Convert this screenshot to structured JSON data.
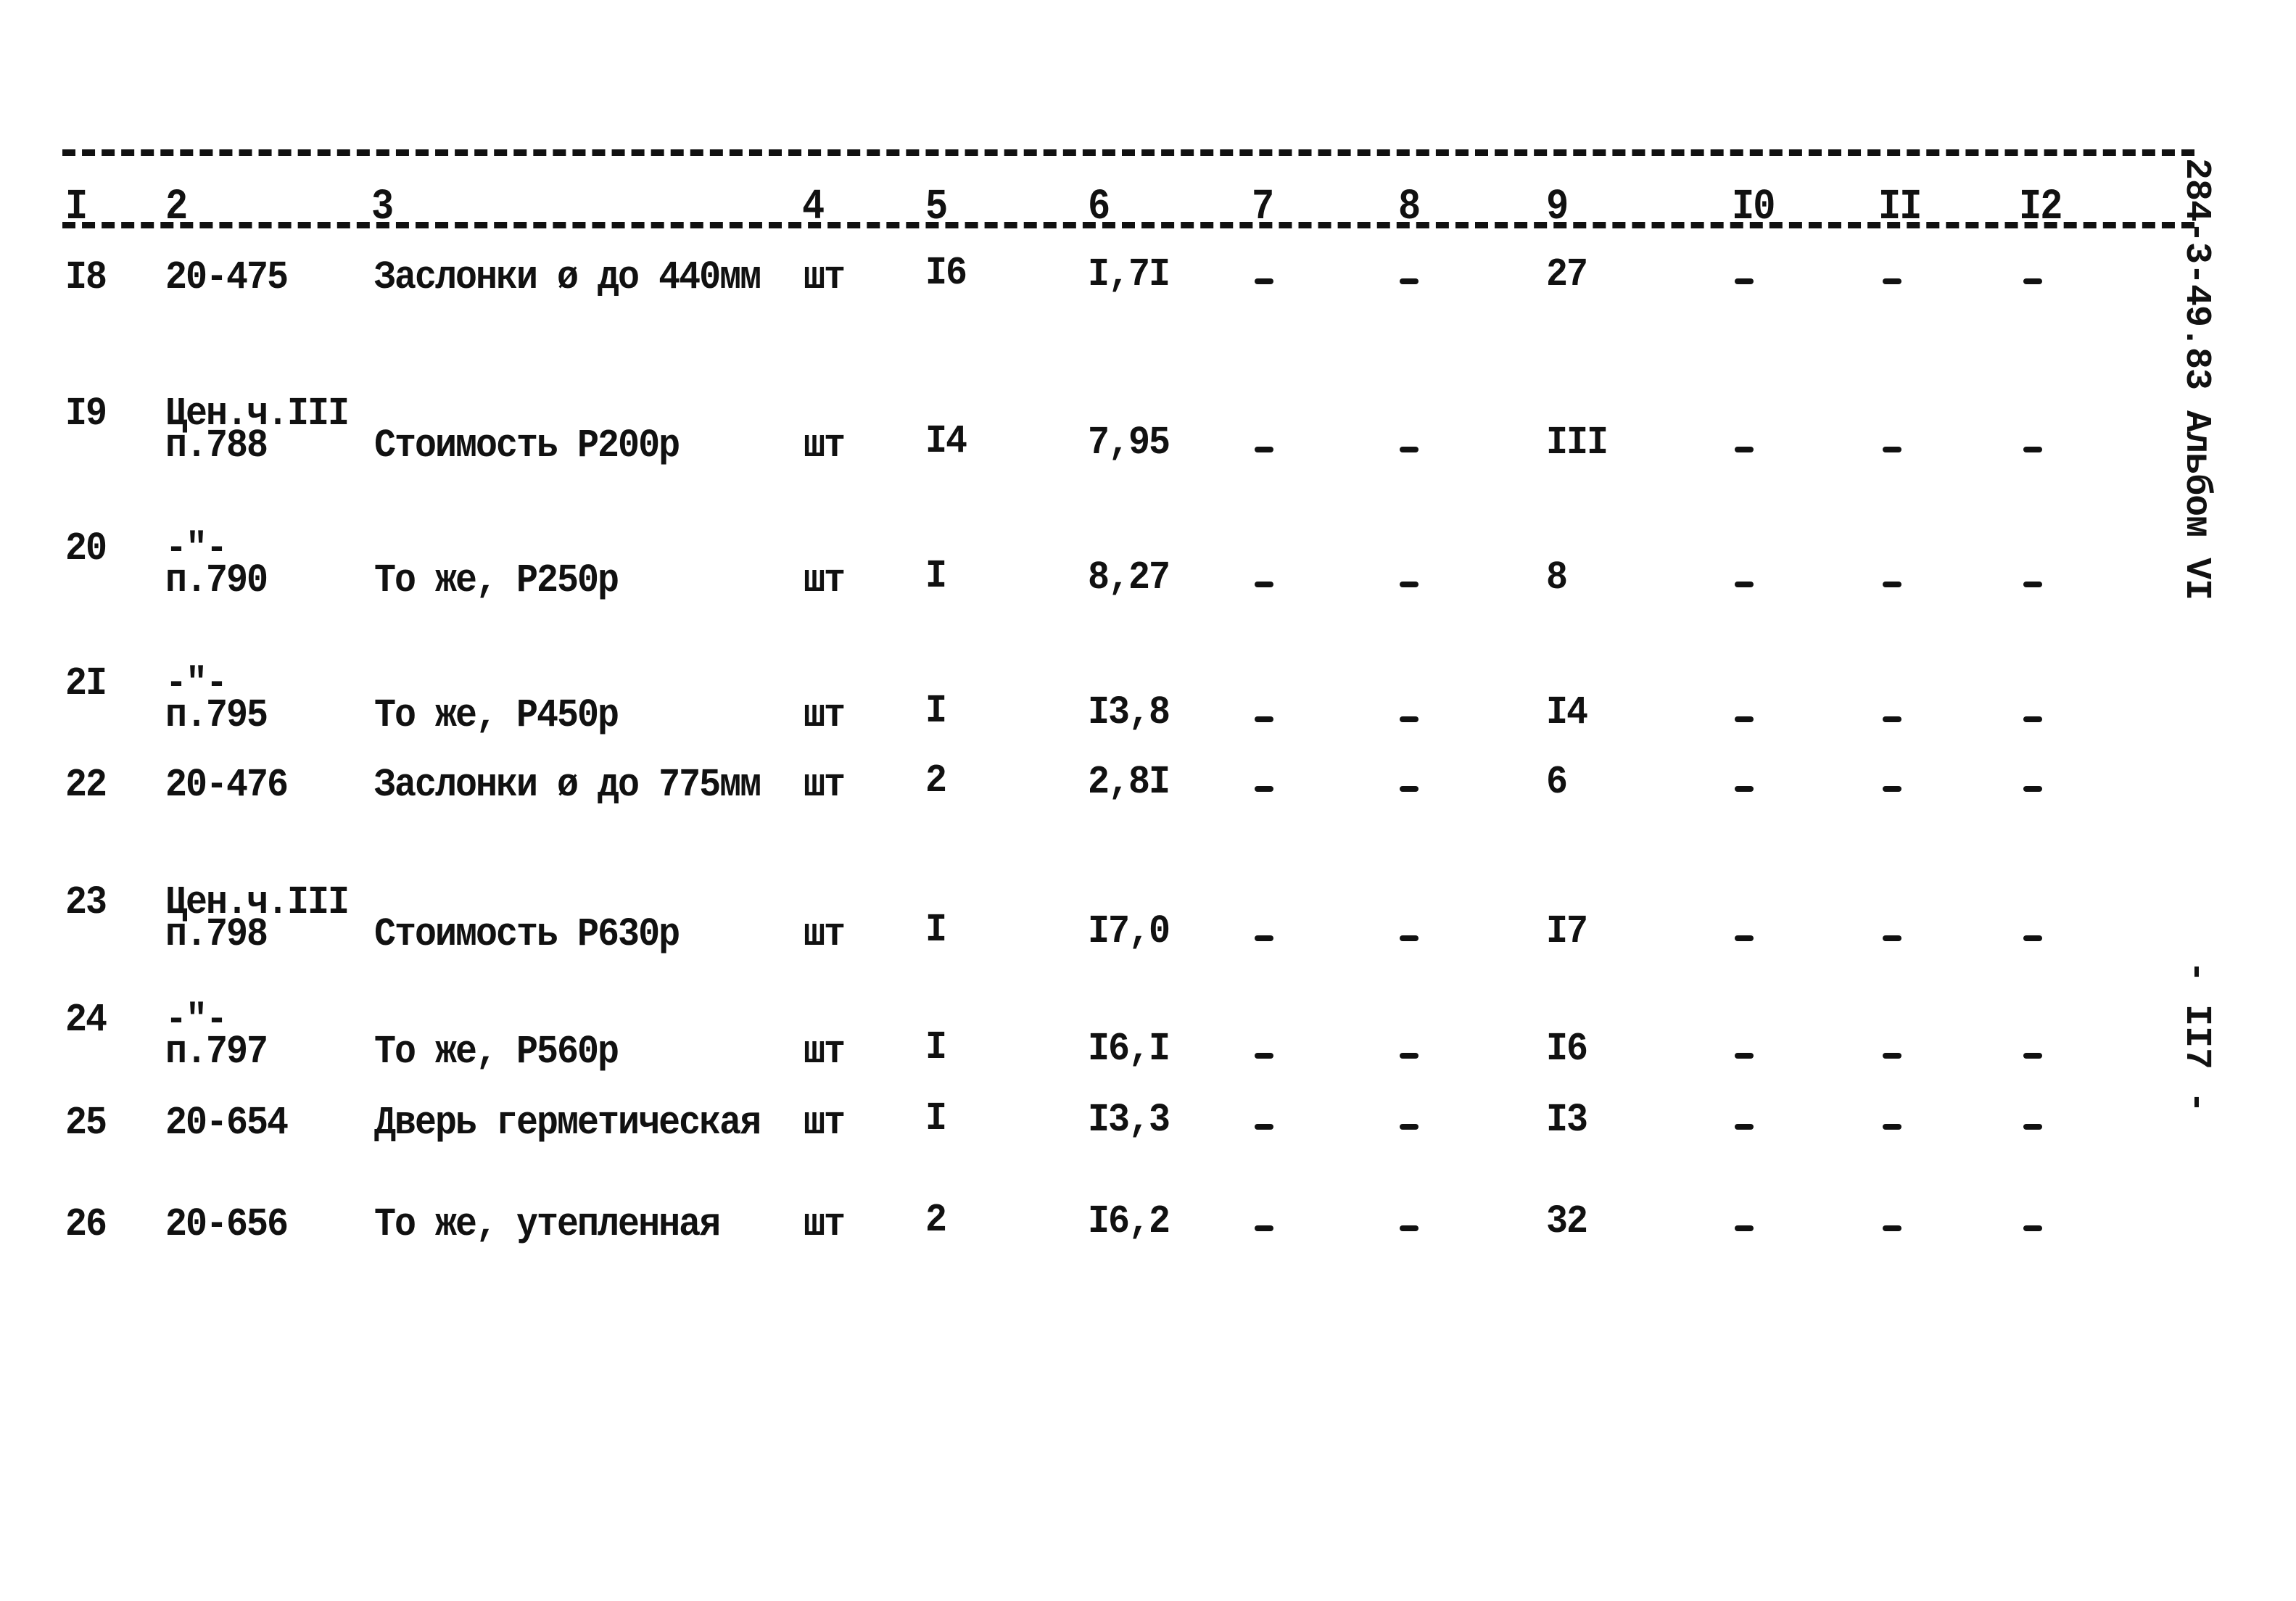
{
  "document": {
    "side_code": "284-3-49.83 Альбом VI",
    "page_number": "- II7 -"
  },
  "table": {
    "column_headers": [
      "I",
      "2",
      "3",
      "4",
      "5",
      "6",
      "7",
      "8",
      "9",
      "I0",
      "II",
      "I2"
    ],
    "rows": [
      {
        "no": "I8",
        "code_line1": "",
        "code_line2": "20-475",
        "name": "Заслонки ø до 440мм",
        "unit": "шт",
        "c5": "I6",
        "c6": "I,7I",
        "c7": "-",
        "c8": "-",
        "c9": "27",
        "c10": "-",
        "c11": "-",
        "c12": "-"
      },
      {
        "no": "I9",
        "code_line1": "Цен.ч.III",
        "code_line2": "п.788",
        "name": "Стоимость Р200р",
        "unit": "шт",
        "c5": "I4",
        "c6": "7,95",
        "c7": "-",
        "c8": "-",
        "c9": "III",
        "c10": "-",
        "c11": "-",
        "c12": "-"
      },
      {
        "no": "20",
        "code_line1": "-\"-",
        "code_line2": "п.790",
        "name": "То же, Р250р",
        "unit": "шт",
        "c5": "I",
        "c6": "8,27",
        "c7": "-",
        "c8": "-",
        "c9": "8",
        "c10": "-",
        "c11": "-",
        "c12": "-"
      },
      {
        "no": "2I",
        "code_line1": "-\"-",
        "code_line2": "п.795",
        "name": "То же, Р450р",
        "unit": "шт",
        "c5": "I",
        "c6": "I3,8",
        "c7": "-",
        "c8": "-",
        "c9": "I4",
        "c10": "-",
        "c11": "-",
        "c12": "-"
      },
      {
        "no": "22",
        "code_line1": "",
        "code_line2": "20-476",
        "name": "Заслонки ø до 775мм",
        "unit": "шт",
        "c5": "2",
        "c6": "2,8I",
        "c7": "-",
        "c8": "-",
        "c9": "6",
        "c10": "-",
        "c11": "-",
        "c12": "-"
      },
      {
        "no": "23",
        "code_line1": "Цен.ч.III",
        "code_line2": "п.798",
        "name": "Стоимость Р630р",
        "unit": "шт",
        "c5": "I",
        "c6": "I7,0",
        "c7": "-",
        "c8": "-",
        "c9": "I7",
        "c10": "-",
        "c11": "-",
        "c12": "-"
      },
      {
        "no": "24",
        "code_line1": "-\"-",
        "code_line2": "п.797",
        "name": "То же, Р560р",
        "unit": "шт",
        "c5": "I",
        "c6": "I6,I",
        "c7": "-",
        "c8": "-",
        "c9": "I6",
        "c10": "-",
        "c11": "-",
        "c12": "-"
      },
      {
        "no": "25",
        "code_line1": "",
        "code_line2": "20-654",
        "name": "Дверь герметическая",
        "unit": "шт",
        "c5": "I",
        "c6": "I3,3",
        "c7": "-",
        "c8": "-",
        "c9": "I3",
        "c10": "-",
        "c11": "-",
        "c12": "-"
      },
      {
        "no": "26",
        "code_line1": "",
        "code_line2": "20-656",
        "name": "То же, утепленная",
        "unit": "шт",
        "c5": "2",
        "c6": "I6,2",
        "c7": "-",
        "c8": "-",
        "c9": "32",
        "c10": "-",
        "c11": "-",
        "c12": "-"
      }
    ]
  }
}
